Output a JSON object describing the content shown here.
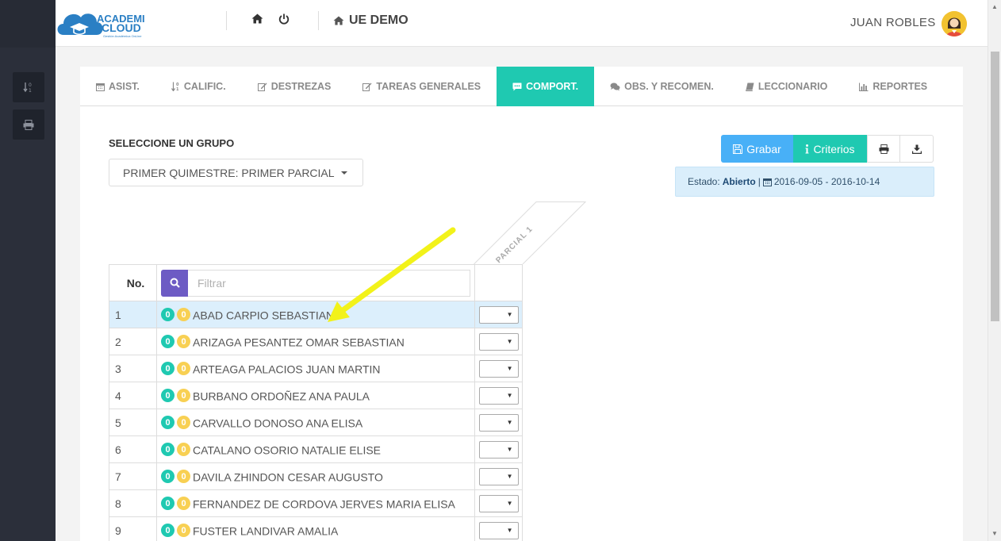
{
  "header": {
    "logo_line1": "ACADEMI",
    "logo_line2": "CLOUD",
    "logo_tagline": "Gestión Académica OnLine",
    "school_name": "UE DEMO",
    "user_name": "JUAN ROBLES",
    "home_icon": "home-icon",
    "power_icon": "power-icon"
  },
  "sidebar": {
    "buttons": [
      {
        "icon": "sort-numeric-icon"
      },
      {
        "icon": "print-icon"
      }
    ]
  },
  "tabs": [
    {
      "label": "ASIST.",
      "icon": "calendar-icon",
      "active": false
    },
    {
      "label": "CALIFIC.",
      "icon": "sort-numeric-icon",
      "active": false
    },
    {
      "label": "DESTREZAS",
      "icon": "edit-icon",
      "active": false
    },
    {
      "label": "TAREAS GENERALES",
      "icon": "edit-icon",
      "active": false
    },
    {
      "label": "COMPORT.",
      "icon": "comment-icon",
      "active": true
    },
    {
      "label": "OBS. Y RECOMEN.",
      "icon": "comments-icon",
      "active": false
    },
    {
      "label": "LECCIONARIO",
      "icon": "book-icon",
      "active": false
    },
    {
      "label": "REPORTES",
      "icon": "bar-chart-icon",
      "active": false
    }
  ],
  "grupo": {
    "label": "SELECCIONE UN GRUPO",
    "selected": "PRIMER QUIMESTRE: PRIMER PARCIAL"
  },
  "actions": {
    "grabar": "Grabar",
    "criterios": "Criterios"
  },
  "estado": {
    "label": "Estado:",
    "value": "Abierto",
    "separator": "|",
    "range": "2016-09-05 - 2016-10-14"
  },
  "table": {
    "col_no": "No.",
    "filter_placeholder": "Filtrar",
    "parcial_header": "PARCIAL 1",
    "rows": [
      {
        "no": "1",
        "a": "0",
        "b": "0",
        "name": "ABAD CARPIO SEBASTIAN",
        "highlight": true
      },
      {
        "no": "2",
        "a": "0",
        "b": "0",
        "name": "ARIZAGA PESANTEZ OMAR SEBASTIAN"
      },
      {
        "no": "3",
        "a": "0",
        "b": "0",
        "name": "ARTEAGA PALACIOS JUAN MARTIN"
      },
      {
        "no": "4",
        "a": "0",
        "b": "0",
        "name": "BURBANO ORDOÑEZ ANA PAULA"
      },
      {
        "no": "5",
        "a": "0",
        "b": "0",
        "name": "CARVALLO DONOSO ANA ELISA"
      },
      {
        "no": "6",
        "a": "0",
        "b": "0",
        "name": "CATALANO OSORIO NATALIE ELISE"
      },
      {
        "no": "7",
        "a": "0",
        "b": "0",
        "name": "DAVILA ZHINDON CESAR AUGUSTO"
      },
      {
        "no": "8",
        "a": "0",
        "b": "0",
        "name": "FERNANDEZ DE CORDOVA JERVES MARIA ELISA"
      },
      {
        "no": "9",
        "a": "0",
        "b": "0",
        "name": "FUSTER LANDIVAR AMALIA"
      }
    ]
  },
  "colors": {
    "accent_teal": "#1fc9b1",
    "primary_blue": "#48b0f7",
    "purple": "#6d5bc4",
    "badge_yellow": "#f8d053",
    "arrow_yellow": "#f2f21a"
  }
}
